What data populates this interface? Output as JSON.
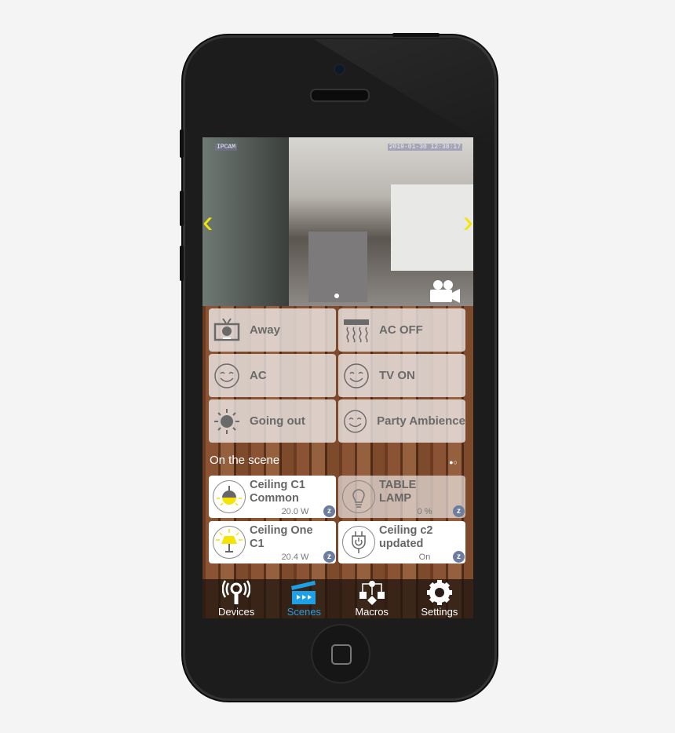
{
  "camera": {
    "label": "IPCAM",
    "timestamp": "2019-01-30 12:38:17",
    "prev": "‹",
    "next": "›"
  },
  "scenes": [
    {
      "label": "Away",
      "icon": "tv-icon"
    },
    {
      "label": "AC OFF",
      "icon": "ac-icon"
    },
    {
      "label": "AC",
      "icon": "smiley-icon"
    },
    {
      "label": "TV ON",
      "icon": "smiley-icon"
    },
    {
      "label": "Going out",
      "icon": "sun-icon"
    },
    {
      "label": "Party Ambience",
      "icon": "smiley-icon"
    }
  ],
  "section_title": "On the scene",
  "pager": "●○",
  "devices": [
    {
      "name1": "Ceiling C1",
      "name2": "Common",
      "value": "20.0 W",
      "icon": "ceiling-lamp-icon",
      "on": true,
      "protocol": "z"
    },
    {
      "name1": "TABLE",
      "name2": "LAMP",
      "value": "0 %",
      "icon": "bulb-icon",
      "on": false,
      "protocol": "z"
    },
    {
      "name1": "Ceiling One",
      "name2": "C1",
      "value": "20.4 W",
      "icon": "table-lamp-icon",
      "on": true,
      "protocol": "z"
    },
    {
      "name1": "Ceiling c2",
      "name2": "updated",
      "value": "On",
      "icon": "plug-icon",
      "on": true,
      "protocol": "z"
    }
  ],
  "tabs": [
    {
      "label": "Devices",
      "active": false
    },
    {
      "label": "Scenes",
      "active": true
    },
    {
      "label": "Macros",
      "active": false
    },
    {
      "label": "Settings",
      "active": false
    }
  ],
  "colors": {
    "accent": "#1ea0e6",
    "arrow": "#f2e600",
    "lamp": "#f5e400"
  }
}
